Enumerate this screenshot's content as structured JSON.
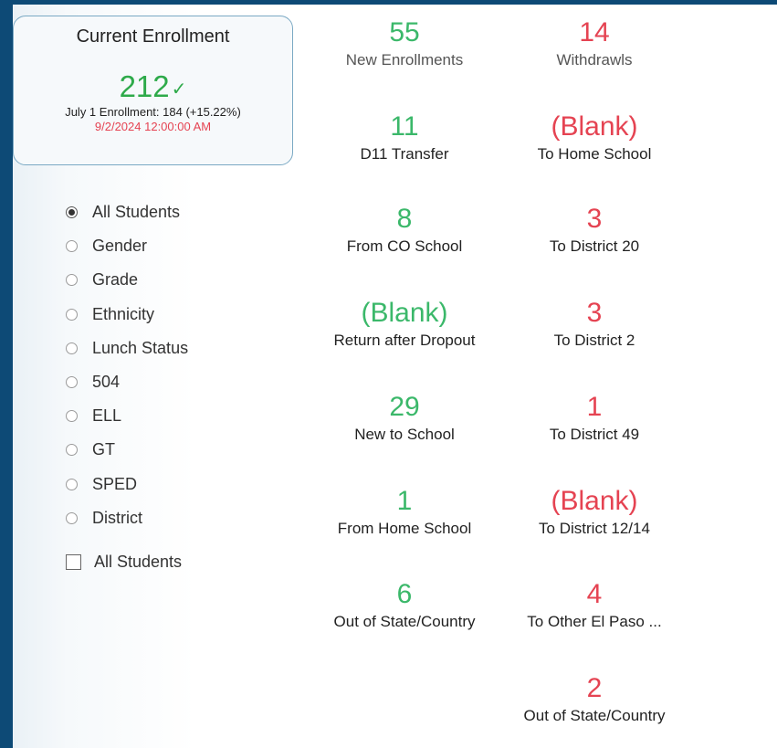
{
  "enrollment_card": {
    "title": "Current Enrollment",
    "total": "212",
    "check_glyph": "✓",
    "july_line": "July 1 Enrollment: 184 (+15.22%)",
    "date_line": "9/2/2024 12:00:00 AM"
  },
  "filters": {
    "selected": "All Students",
    "options": [
      "All Students",
      "Gender",
      "Grade",
      "Ethnicity",
      "Lunch Status",
      "504",
      "ELL",
      "GT",
      "SPED",
      "District"
    ],
    "checkbox_label": "All Students",
    "checkbox_checked": false
  },
  "enrollments": [
    {
      "value": "55",
      "label": "New Enrollments"
    },
    {
      "value": "11",
      "label": "D11 Transfer"
    },
    {
      "value": "8",
      "label": "From CO School"
    },
    {
      "value": "(Blank)",
      "label": "Return after Dropout"
    },
    {
      "value": "29",
      "label": "New to School"
    },
    {
      "value": "1",
      "label": "From Home School"
    },
    {
      "value": "6",
      "label": "Out of State/Country"
    }
  ],
  "withdrawals": [
    {
      "value": "14",
      "label": "Withdrawls"
    },
    {
      "value": "(Blank)",
      "label": "To Home School"
    },
    {
      "value": "3",
      "label": "To District 20"
    },
    {
      "value": "3",
      "label": "To District 2"
    },
    {
      "value": "1",
      "label": "To District 49"
    },
    {
      "value": "(Blank)",
      "label": "To District 12/14"
    },
    {
      "value": "4",
      "label": "To Other El Paso ..."
    },
    {
      "value": "2",
      "label": "Out of State/Country"
    }
  ],
  "colors": {
    "frame": "#0d4a76",
    "positive": "#3bb86a",
    "negative": "#e54352",
    "total": "#2eaa4a"
  }
}
